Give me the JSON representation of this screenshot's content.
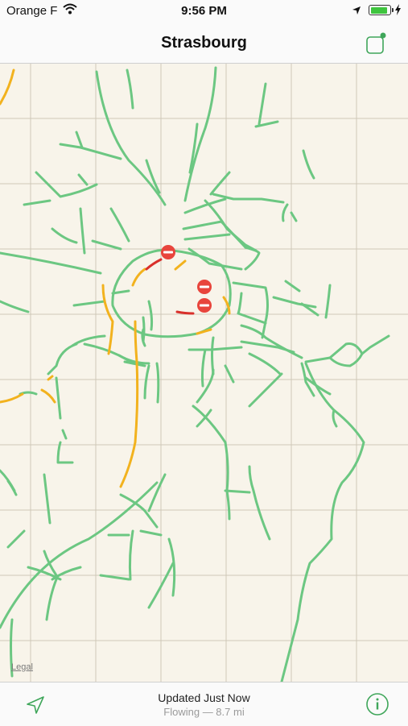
{
  "status_bar": {
    "carrier": "Orange F",
    "time": "9:56 PM",
    "battery_level": 0.9,
    "wifi_icon": "wifi-icon",
    "location_icon": "location-arrow-icon",
    "charging_icon": "bolt-icon"
  },
  "nav": {
    "title": "Strasbourg",
    "layers_icon": "layers-icon"
  },
  "map": {
    "legal_label": "Legal",
    "colors": {
      "background": "#f8f4ea",
      "grid": "#cfc8b8",
      "flowing": "#6cc782",
      "slow": "#f2b21e",
      "heavy": "#d9302b",
      "incident": "#e8453c"
    },
    "incident_icon": "road-closed-icon",
    "incident_count": 3
  },
  "toolbar": {
    "status_title": "Updated Just Now",
    "status_subtitle": "Flowing — 8.7 mi",
    "locate_icon": "location-arrow-icon",
    "info_icon": "info-icon"
  }
}
